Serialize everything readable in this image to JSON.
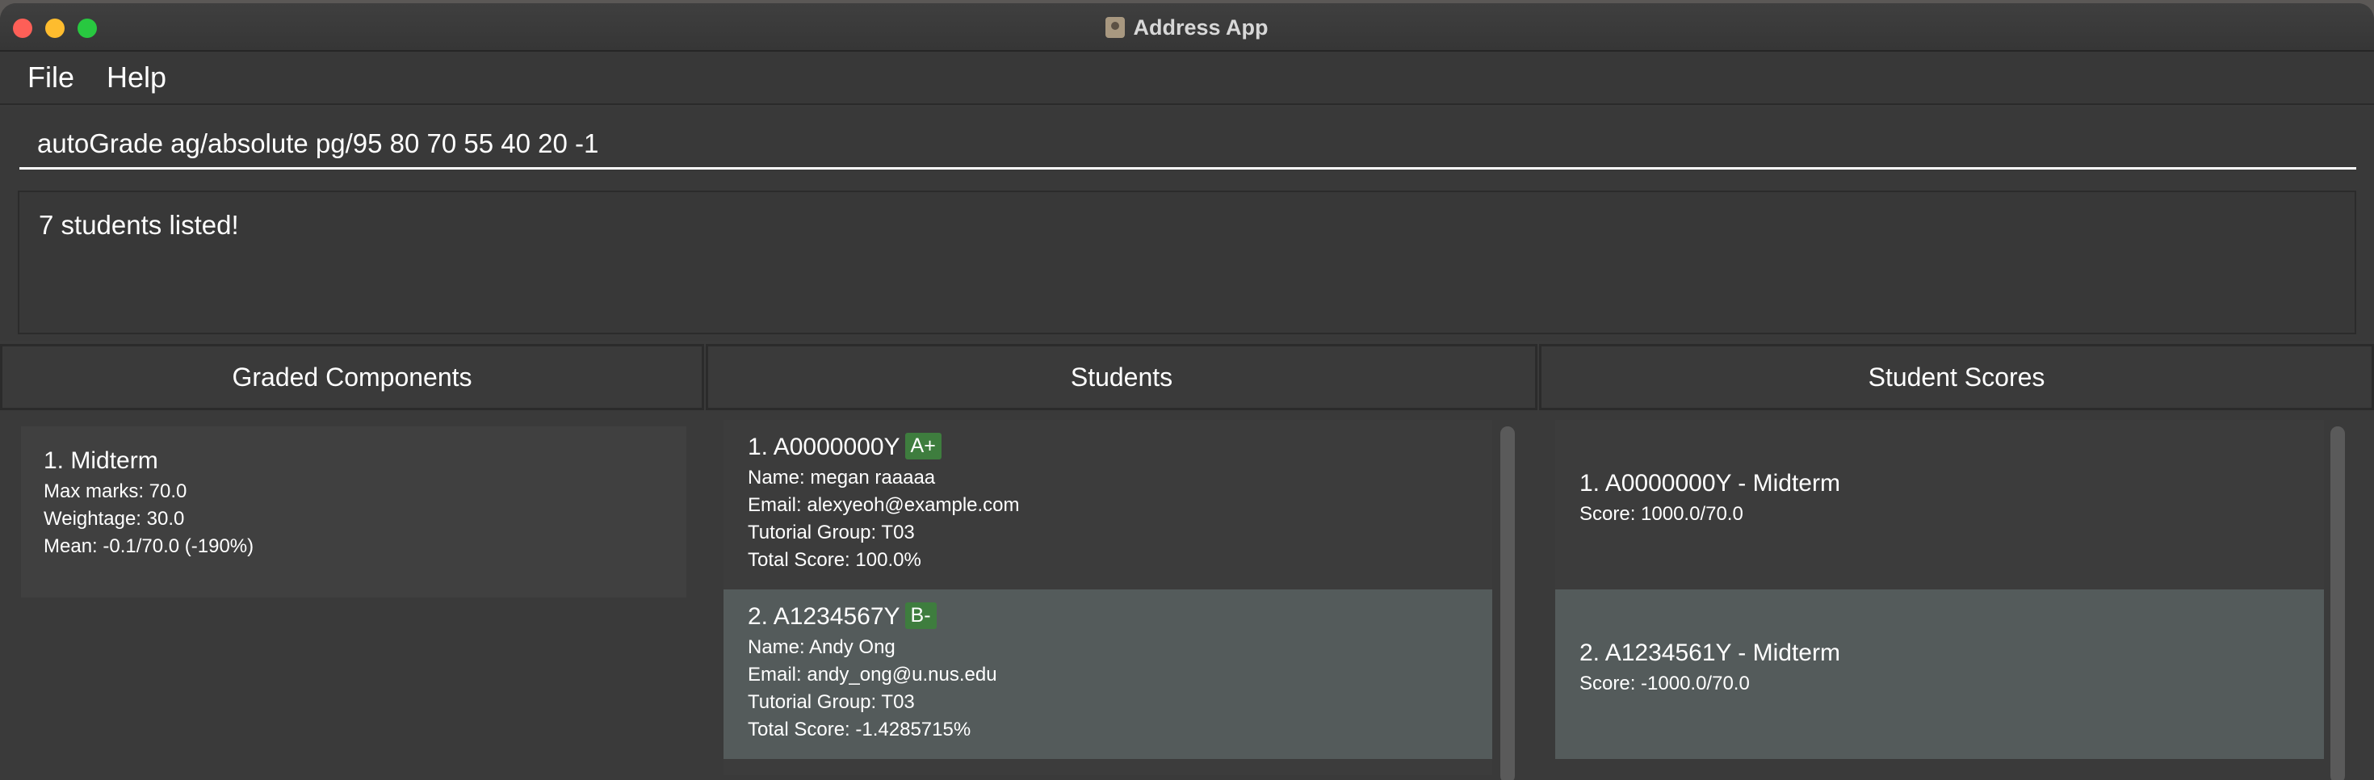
{
  "window": {
    "title": "Address App"
  },
  "menu": {
    "file": "File",
    "help": "Help"
  },
  "command": {
    "value": "autoGrade ag/absolute pg/95 80 70 55 40 20 -1"
  },
  "result": {
    "text": "7 students listed!"
  },
  "panels": {
    "components": {
      "header": "Graded Components",
      "items": [
        {
          "title": "1.  Midterm",
          "max_marks": "Max marks: 70.0",
          "weightage": "Weightage: 30.0",
          "mean": "Mean: -0.1/70.0 (-190%)"
        }
      ]
    },
    "students": {
      "header": "Students",
      "items": [
        {
          "title": "1.  A0000000Y",
          "grade": "A+",
          "name": "Name: megan raaaaa",
          "email": "Email: alexyeoh@example.com",
          "tutorial": "Tutorial Group: T03",
          "total": "Total Score: 100.0%"
        },
        {
          "title": "2.  A1234567Y",
          "grade": "B-",
          "name": "Name: Andy Ong",
          "email": "Email: andy_ong@u.nus.edu",
          "tutorial": "Tutorial Group: T03",
          "total": "Total Score: -1.4285715%"
        }
      ]
    },
    "scores": {
      "header": "Student Scores",
      "items": [
        {
          "title": "1.  A0000000Y - Midterm",
          "score": "Score: 1000.0/70.0"
        },
        {
          "title": "2.  A1234561Y - Midterm",
          "score": "Score: -1000.0/70.0"
        }
      ]
    }
  },
  "colors": {
    "grade_badge": "#3e7d3e",
    "selected_row": "#545b5b",
    "background": "#3a3a3a"
  }
}
